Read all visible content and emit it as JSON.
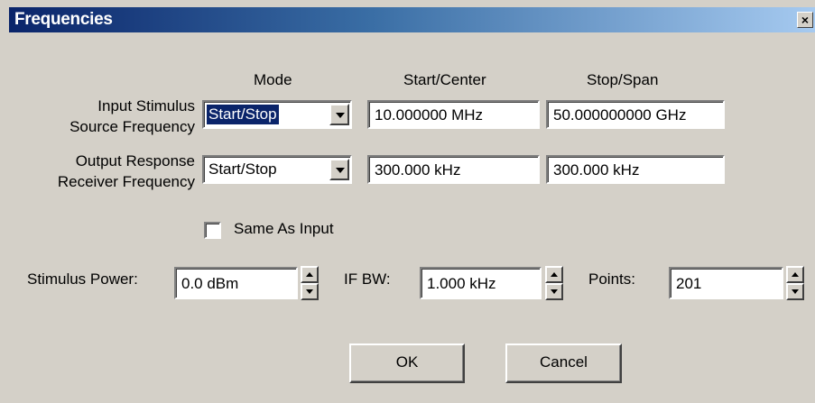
{
  "window": {
    "title": "Frequencies",
    "close_glyph": "×"
  },
  "headers": {
    "mode": "Mode",
    "start_center": "Start/Center",
    "stop_span": "Stop/Span"
  },
  "input_row": {
    "label_line1": "Input Stimulus",
    "label_line2": "Source Frequency",
    "mode_value": "Start/Stop",
    "start_value": "10.000000 MHz",
    "stop_value": "50.000000000 GHz"
  },
  "output_row": {
    "label_line1": "Output Response",
    "label_line2": "Receiver Frequency",
    "mode_value": "Start/Stop",
    "start_value": "300.000 kHz",
    "stop_value": "300.000 kHz"
  },
  "same_as_input": {
    "label": "Same As Input",
    "checked": false
  },
  "stimulus_power": {
    "label": "Stimulus Power:",
    "value": "0.0 dBm"
  },
  "if_bw": {
    "label": "IF BW:",
    "value": "1.000 kHz"
  },
  "points": {
    "label": "Points:",
    "value": "201"
  },
  "buttons": {
    "ok": "OK",
    "cancel": "Cancel"
  },
  "icons": {
    "close": "close-icon",
    "dropdown": "chevron-down-icon",
    "spin_up": "arrow-up-icon",
    "spin_down": "arrow-down-icon"
  }
}
